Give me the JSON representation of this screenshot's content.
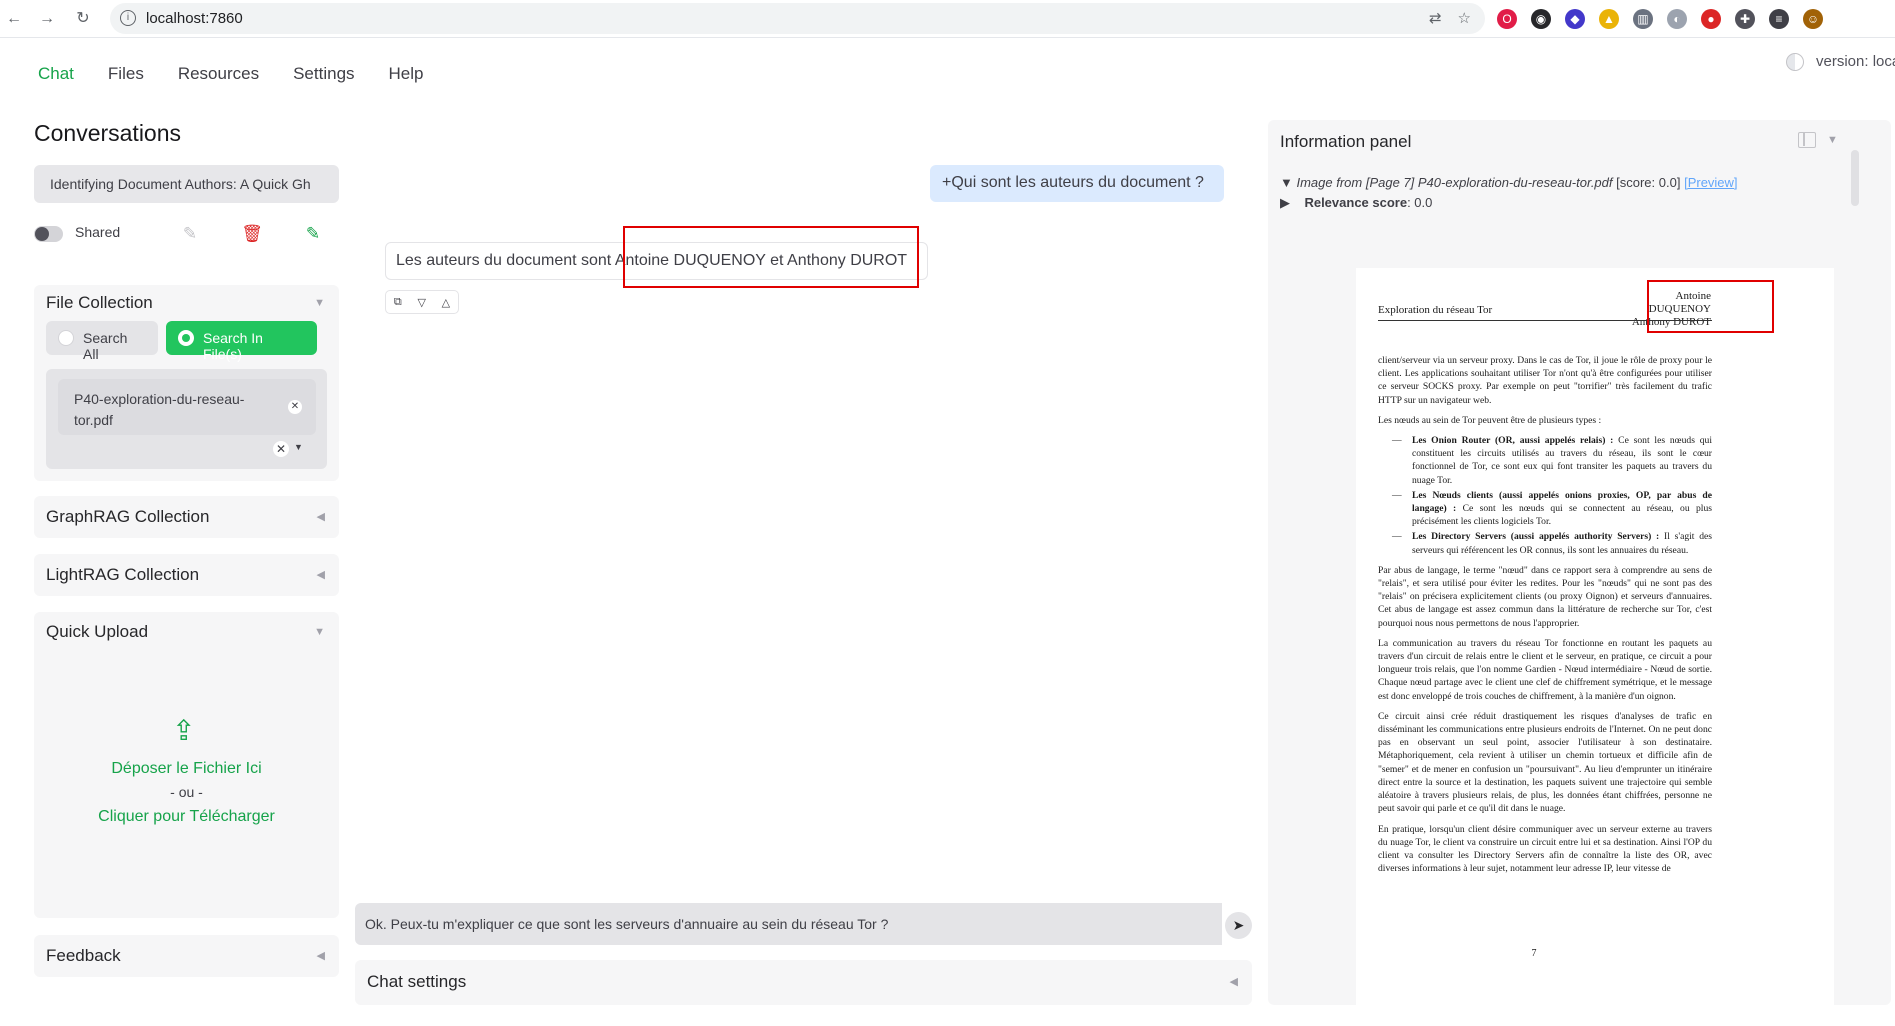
{
  "browser": {
    "url": "localhost:7860",
    "back_icon": "arrow-left-icon",
    "forward_icon": "arrow-right-icon",
    "reload_icon": "reload-icon"
  },
  "tabs": [
    {
      "label": "Chat",
      "active": true
    },
    {
      "label": "Files",
      "active": false
    },
    {
      "label": "Resources",
      "active": false
    },
    {
      "label": "Settings",
      "active": false
    },
    {
      "label": "Help",
      "active": false
    }
  ],
  "version_text": "version: loca",
  "conversations": {
    "title": "Conversations",
    "selected": "Identifying Document Authors: A Quick Gh",
    "shared_label": "Shared",
    "shared_on": false
  },
  "file_collection": {
    "title": "File Collection",
    "search_all_label": "Search All",
    "search_files_label": "Search In File(s)",
    "selected_mode": "Search In File(s)",
    "file_name_line1": "P40-exploration-du-reseau-",
    "file_name_line2": "tor.pdf"
  },
  "graphrag": {
    "title": "GraphRAG Collection"
  },
  "lightrag": {
    "title": "LightRAG Collection"
  },
  "quick_upload": {
    "title": "Quick Upload",
    "drop_text": "Déposer le Fichier Ici",
    "or_text": "- ou -",
    "click_text": "Cliquer pour Télécharger"
  },
  "feedback": {
    "title": "Feedback"
  },
  "chat": {
    "user_message": "+Qui sont les auteurs du document ?",
    "bot_message_prefix": "Les auteurs du document sont ",
    "bot_message_highlight": "Antoine DUQUENOY et Anthony DUROT",
    "input_value": "Ok. Peux-tu m'expliquer ce que sont les serveurs d'annuaire au sein du réseau Tor ?",
    "settings_title": "Chat settings"
  },
  "info_panel": {
    "title": "Information panel",
    "image_label": "Image from [Page 7] P40-exploration-du-reseau-tor.pdf",
    "score_text": "[score: 0.0]",
    "preview_text": "[Preview]",
    "relevance_label": "Relevance score",
    "relevance_value": ": 0.0"
  },
  "pdf": {
    "header_left": "Exploration du réseau Tor",
    "author1": "Antoine DUQUENOY",
    "author2": "Anthony DUROT",
    "p1": "client/serveur via un serveur proxy. Dans le cas de Tor, il joue le rôle de proxy pour le client. Les applications souhaitant utiliser Tor n'ont qu'à être configurées pour utiliser ce serveur SOCKS proxy. Par exemple on peut \"torrifier\" très facilement du trafic HTTP sur un navigateur web.",
    "p2": "Les nœuds au sein de Tor peuvent être de plusieurs types :",
    "item1_bold": "Les Onion Router (OR, aussi appelés relais) :",
    "item1_text": " Ce sont les nœuds qui constituent les circuits utilisés au travers du réseau, ils sont le cœur fonctionnel de Tor, ce sont eux qui font transiter les paquets au travers du nuage Tor.",
    "item2_bold": "Les Nœuds clients (aussi appelés onions proxies, OP, par abus de langage) :",
    "item2_text": " Ce sont les nœuds qui se connectent au réseau, ou plus précisément les clients logiciels Tor.",
    "item3_bold": "Les Directory Servers (aussi appelés authority Servers) :",
    "item3_text": " Il s'agit des serveurs qui référencent les OR connus, ils sont les annuaires du réseau.",
    "p3": "Par abus de langage, le terme \"nœud\" dans ce rapport sera à comprendre au sens de \"relais\", et sera utilisé pour éviter les redites. Pour les \"nœuds\" qui ne sont pas des \"relais\" on précisera explicitement clients (ou proxy Oignon) et serveurs d'annuaires. Cet abus de langage est assez commun dans la littérature de recherche sur Tor, c'est pourquoi nous nous permettons de nous l'approprier.",
    "p4": "La communication au travers du réseau Tor fonctionne en routant les paquets au travers d'un circuit de relais entre le client et le serveur, en pratique, ce circuit a pour longueur trois relais, que l'on nomme Gardien - Nœud intermédiaire - Nœud de sortie. Chaque nœud partage avec le client une clef de chiffrement symétrique, et le message est donc enveloppé de trois couches de chiffrement, à la manière d'un oignon.",
    "p5": "Ce circuit ainsi crée réduit drastiquement les risques d'analyses de trafic en disséminant les communications entre plusieurs endroits de l'Internet. On ne peut donc pas en observant un seul point, associer l'utilisateur à son destinataire. Métaphoriquement, cela revient à utiliser un chemin tortueux et difficile afin de \"semer\" et de mener en confusion un \"poursuivant\". Au lieu d'emprunter un itinéraire direct entre la source et la destination, les paquets suivent une trajectoire qui semble aléatoire à travers plusieurs relais, de plus, les données étant chiffrées, personne ne peut savoir qui parle et ce qu'il dit dans le nuage.",
    "p6": "En pratique, lorsqu'un client désire communiquer avec un serveur externe au travers du nuage Tor, le client va construire un circuit entre lui et sa destination. Ainsi l'OP du client va consulter les Directory Servers afin de connaître la liste des OR, avec diverses informations à leur sujet, notamment leur adresse IP, leur vitesse de",
    "page_number": "7"
  },
  "colors": {
    "accent": "#16a34a",
    "delete": "#dc2626",
    "highlight": "#e00000",
    "user_bubble": "#dbeafe"
  }
}
